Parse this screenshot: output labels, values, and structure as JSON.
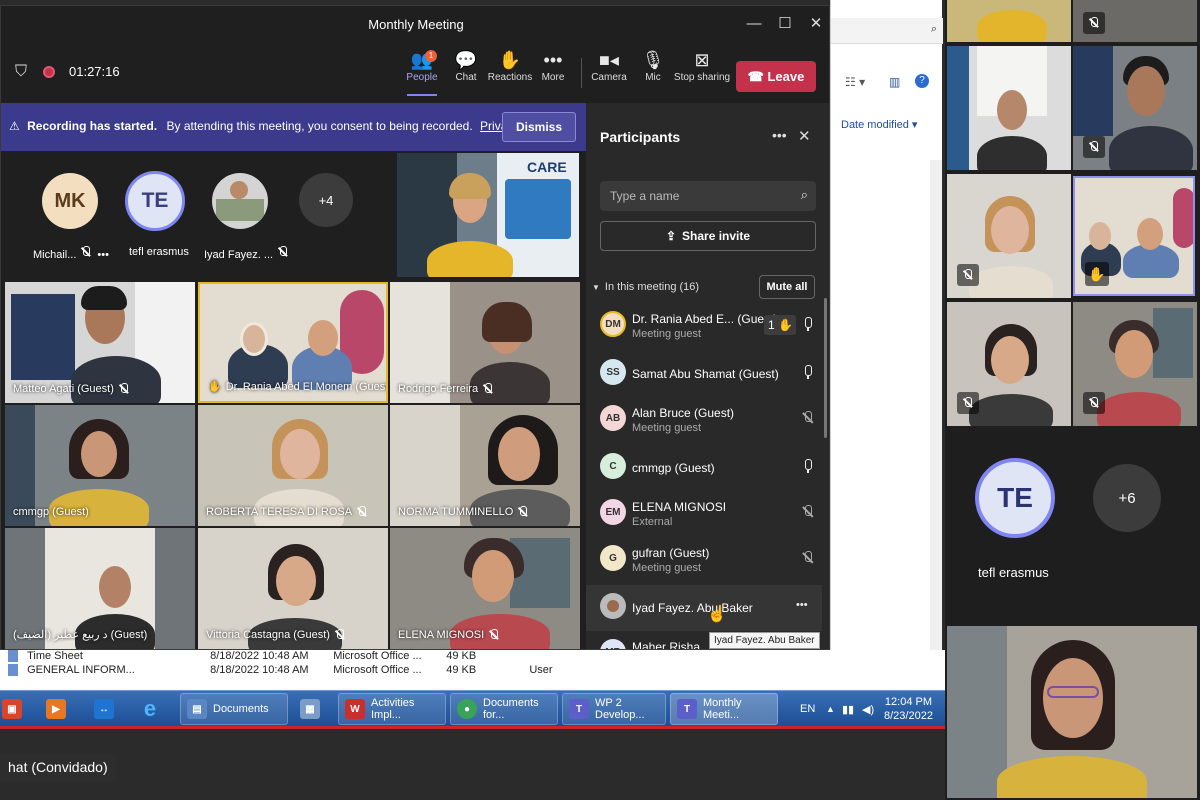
{
  "window": {
    "title": "Monthly Meeting"
  },
  "callbar": {
    "timer": "01:27:16",
    "people": {
      "label": "People",
      "badge": "1"
    },
    "chat": {
      "label": "Chat"
    },
    "reactions": {
      "label": "Reactions"
    },
    "more": {
      "label": "More"
    },
    "camera": {
      "label": "Camera"
    },
    "mic": {
      "label": "Mic"
    },
    "stop_sharing": {
      "label": "Stop sharing"
    },
    "leave": {
      "label": "Leave"
    }
  },
  "recording_banner": {
    "bold": "Recording has started.",
    "text": "By attending this meeting, you consent to being recorded.",
    "link": "Privacy p...",
    "dismiss": "Dismiss"
  },
  "top_avatars": [
    {
      "initials": "MK",
      "name": "Michail...",
      "color": "#f3dfc0"
    },
    {
      "initials": "TE",
      "name": "tefl erasmus",
      "color": "#dfe5f5"
    },
    {
      "initials": "",
      "name": "Iyad Fayez. ...",
      "color": "#cccccc"
    }
  ],
  "more_count": "+4",
  "video_tiles": [
    {
      "name": "Matteo Agati (Guest)"
    },
    {
      "name": "Dr. Rania Abed El Monem (Guest)"
    },
    {
      "name": "Rodrigo Ferreira"
    },
    {
      "name": "cmmgp (Guest)"
    },
    {
      "name": "ROBERTA TERESA DI ROSA"
    },
    {
      "name": "NORMA TUMMINELLO"
    },
    {
      "name": "د ربيع عطير (الضيف) (Guest)"
    },
    {
      "name": "Vittoria Castagna (Guest)"
    },
    {
      "name": "ELENA MIGNOSI"
    }
  ],
  "poster_text": "CARE",
  "participants": {
    "title": "Participants",
    "search_placeholder": "Type a name",
    "share_invite": "Share invite",
    "in_meeting": "In this meeting (16)",
    "mute_all": "Mute all",
    "hand_count": "1",
    "list": [
      {
        "initials": "DM",
        "name": "Dr. Rania Abed E... (Guest)",
        "sub": "Meeting guest",
        "color": "#f3dfc0",
        "mic": "on"
      },
      {
        "initials": "SS",
        "name": "Samat Abu Shamat (Guest)",
        "sub": "",
        "color": "#d6e8ef",
        "mic": "on"
      },
      {
        "initials": "AB",
        "name": "Alan Bruce (Guest)",
        "sub": "Meeting guest",
        "color": "#f5d6d6",
        "mic": "off"
      },
      {
        "initials": "C",
        "name": "cmmgp (Guest)",
        "sub": "",
        "color": "#d8eedc",
        "mic": "on"
      },
      {
        "initials": "EM",
        "name": "ELENA MIGNOSI",
        "sub": "External",
        "color": "#f2d6e3",
        "mic": "off"
      },
      {
        "initials": "G",
        "name": "gufran (Guest)",
        "sub": "Meeting guest",
        "color": "#f3e7c9",
        "mic": "off"
      },
      {
        "initials": "",
        "name": "Iyad Fayez. Abu Baker",
        "sub": "",
        "color": "#bbbbbb",
        "mic": "more"
      },
      {
        "initials": "MR",
        "name": "Maher Risha",
        "sub": "",
        "color": "#dfe5f5",
        "mic": "off"
      }
    ],
    "tooltip": "Iyad Fayez. Abu Baker"
  },
  "explorer": {
    "date_modified": "Date modified",
    "rows": [
      {
        "name": "Time Sheet",
        "date": "8/18/2022 10:48 AM",
        "type": "Microsoft Office ...",
        "size": "49 KB",
        "owner": ""
      },
      {
        "name": "GENERAL INFORM...",
        "date": "8/18/2022 10:48 AM",
        "type": "Microsoft Office ...",
        "size": "49 KB",
        "owner": "User"
      }
    ]
  },
  "taskbar": {
    "apps": [
      {
        "label": "Documents",
        "color": "#5a86c4"
      },
      {
        "label": "Activities Impl...",
        "color": "#c9302c"
      },
      {
        "label": "Documents for...",
        "color": "#3aa35a"
      },
      {
        "label": "WP 2 Develop...",
        "color": "#5b5fc7"
      },
      {
        "label": "Monthly Meeti...",
        "color": "#5b5fc7"
      }
    ],
    "lang": "EN",
    "time": "12:04 PM",
    "date": "8/23/2022"
  },
  "bottom_label": "hat (Convidado)",
  "gallery": {
    "avatar_initials": "TE",
    "avatar_name": "tefl erasmus",
    "more_count": "+6"
  }
}
